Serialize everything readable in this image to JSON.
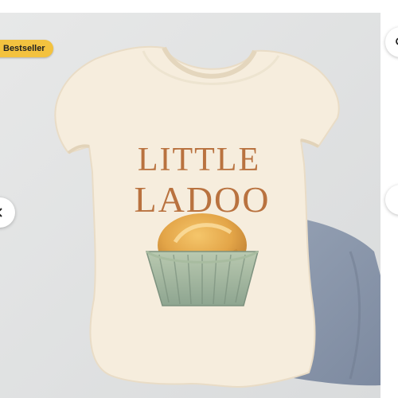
{
  "badge": {
    "label": "Bestseller",
    "color": "#f3c23f"
  },
  "product": {
    "print_line1": "LITTLE",
    "print_line2": "LADOO",
    "print_color": "#b9723f",
    "garment_color": "#f6eddd",
    "shorts_color": "#8a98ad"
  },
  "controls": {
    "prev_icon": "chevron-left-icon",
    "next_icon": "chevron-right-icon",
    "favorite_icon": "search-icon"
  }
}
